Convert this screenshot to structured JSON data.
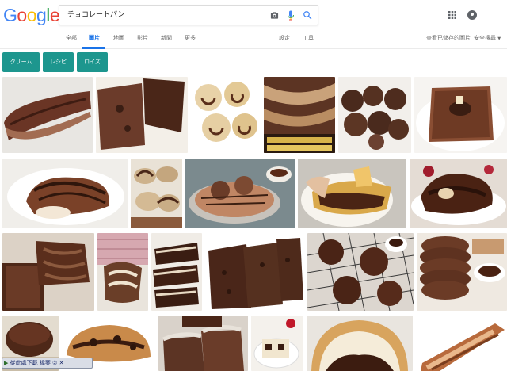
{
  "logo": [
    "G",
    "o",
    "o",
    "g",
    "l",
    "e"
  ],
  "logo_colors": [
    "#4285F4",
    "#EA4335",
    "#FBBC05",
    "#4285F4",
    "#34A853",
    "#EA4335"
  ],
  "search": {
    "query": "チョコレートパン"
  },
  "icons": {
    "camera": "camera-icon",
    "mic": "mic-icon",
    "search": "search-icon",
    "apps": "apps-grid-icon",
    "avatar": "account-avatar"
  },
  "tabs": [
    {
      "label": "全部",
      "active": false
    },
    {
      "label": "圖片",
      "active": true
    },
    {
      "label": "地圖",
      "active": false
    },
    {
      "label": "影片",
      "active": false
    },
    {
      "label": "新聞",
      "active": false
    },
    {
      "label": "更多",
      "active": false
    }
  ],
  "settings_label": "設定",
  "tools_label": "工具",
  "saved_images_label": "查看已儲存的圖片",
  "safe_search_label": "安全搜尋",
  "chips": [
    "クリーム",
    "レシピ",
    "ロイズ"
  ],
  "accent_color": "#1a73e8",
  "chip_color": "#1d968e",
  "download_bar": {
    "label": "從此處下載 檔案",
    "count": "②"
  }
}
